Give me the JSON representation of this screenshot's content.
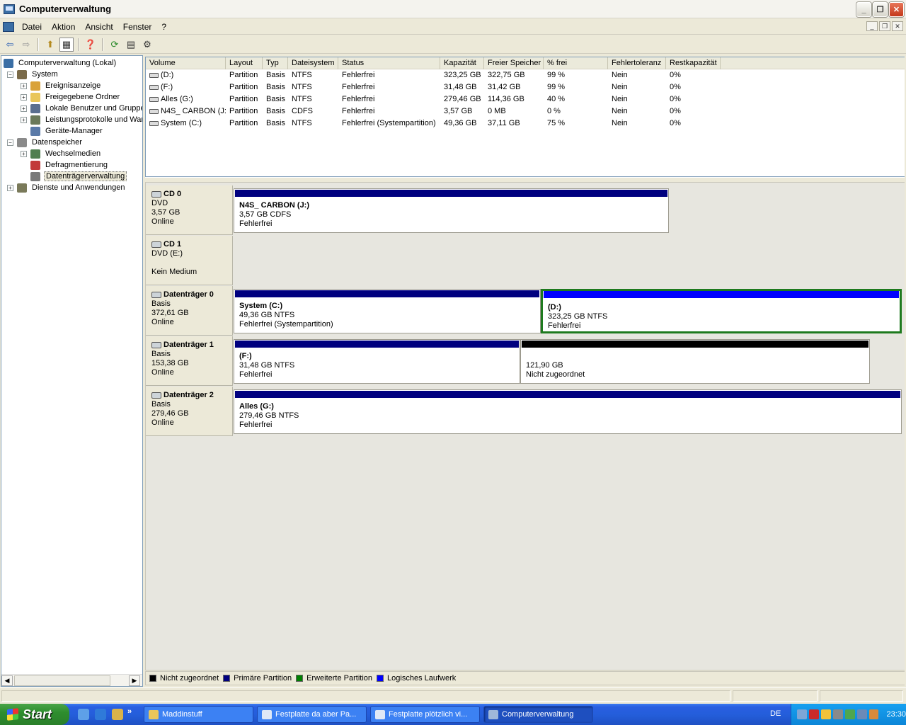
{
  "window": {
    "title": "Computerverwaltung"
  },
  "menu": {
    "items": [
      "Datei",
      "Aktion",
      "Ansicht",
      "Fenster",
      "?"
    ]
  },
  "tree": {
    "items": [
      {
        "label": "Computerverwaltung (Lokal)",
        "level": 0,
        "expander": "",
        "icon": "computer-icon",
        "color": "#3a6ea5"
      },
      {
        "label": "System",
        "level": 1,
        "expander": "−",
        "icon": "system-tools-icon",
        "color": "#7a6a48"
      },
      {
        "label": "Ereignisanzeige",
        "level": 2,
        "expander": "+",
        "icon": "event-viewer-icon",
        "color": "#d9a23a"
      },
      {
        "label": "Freigegebene Ordner",
        "level": 2,
        "expander": "+",
        "icon": "shared-folder-icon",
        "color": "#e9c65a"
      },
      {
        "label": "Lokale Benutzer und Gruppen",
        "level": 2,
        "expander": "+",
        "icon": "users-icon",
        "color": "#5a6f8f"
      },
      {
        "label": "Leistungsprotokolle und Warnungen",
        "level": 2,
        "expander": "+",
        "icon": "performance-icon",
        "color": "#6b7a5a"
      },
      {
        "label": "Geräte-Manager",
        "level": 2,
        "expander": "",
        "icon": "device-manager-icon",
        "color": "#5a7aa8"
      },
      {
        "label": "Datenspeicher",
        "level": 1,
        "expander": "−",
        "icon": "storage-icon",
        "color": "#8a8a8a"
      },
      {
        "label": "Wechselmedien",
        "level": 2,
        "expander": "+",
        "icon": "removable-media-icon",
        "color": "#4f7f4f"
      },
      {
        "label": "Defragmentierung",
        "level": 2,
        "expander": "",
        "icon": "defrag-icon",
        "color": "#c23a3a"
      },
      {
        "label": "Datenträgerverwaltung",
        "level": 2,
        "expander": "",
        "icon": "disk-management-icon",
        "color": "#7a7a7a",
        "selected": true
      },
      {
        "label": "Dienste und Anwendungen",
        "level": 1,
        "expander": "+",
        "icon": "services-icon",
        "color": "#7a7a5a"
      }
    ]
  },
  "volumes": {
    "columns": [
      "Volume",
      "Layout",
      "Typ",
      "Dateisystem",
      "Status",
      "Kapazität",
      "Freier Speicher",
      "% frei",
      "Fehlertoleranz",
      "Restkapazität"
    ],
    "rows": [
      [
        "(D:)",
        "Partition",
        "Basis",
        "NTFS",
        "Fehlerfrei",
        "323,25 GB",
        "322,75 GB",
        "99 %",
        "Nein",
        "0%"
      ],
      [
        "(F:)",
        "Partition",
        "Basis",
        "NTFS",
        "Fehlerfrei",
        "31,48 GB",
        "31,42 GB",
        "99 %",
        "Nein",
        "0%"
      ],
      [
        "Alles (G:)",
        "Partition",
        "Basis",
        "NTFS",
        "Fehlerfrei",
        "279,46 GB",
        "114,36 GB",
        "40 %",
        "Nein",
        "0%"
      ],
      [
        "N4S_ CARBON (J:)",
        "Partition",
        "Basis",
        "CDFS",
        "Fehlerfrei",
        "3,57 GB",
        "0 MB",
        "0 %",
        "Nein",
        "0%"
      ],
      [
        "System (C:)",
        "Partition",
        "Basis",
        "NTFS",
        "Fehlerfrei (Systempartition)",
        "49,36 GB",
        "37,11 GB",
        "75 %",
        "Nein",
        "0%"
      ]
    ]
  },
  "disks": [
    {
      "name": "CD 0",
      "type": "DVD",
      "size": "3,57 GB",
      "state": "Online",
      "partitions": [
        {
          "name": "N4S_ CARBON  (J:)",
          "size": "3,57 GB CDFS",
          "status": "Fehlerfrei",
          "kind": "primary",
          "share": 1.0
        }
      ],
      "used": 0.652
    },
    {
      "name": "CD 1",
      "type": "DVD (E:)",
      "size": "",
      "state": "Kein Medium",
      "partitions": [],
      "used": 0
    },
    {
      "name": "Datenträger 0",
      "type": "Basis",
      "size": "372,61 GB",
      "state": "Online",
      "partitions": [
        {
          "name": "System  (C:)",
          "size": "49,36 GB NTFS",
          "status": "Fehlerfrei (Systempartition)",
          "kind": "primary",
          "share": 0.46
        },
        {
          "name": "(D:)",
          "size": "323,25 GB NTFS",
          "status": "Fehlerfrei",
          "kind": "logical",
          "share": 0.54,
          "selected": true
        }
      ],
      "used": 1.0
    },
    {
      "name": "Datenträger 1",
      "type": "Basis",
      "size": "153,38 GB",
      "state": "Online",
      "partitions": [
        {
          "name": "(F:)",
          "size": "31,48 GB NTFS",
          "status": "Fehlerfrei",
          "kind": "primary",
          "share": 0.45
        },
        {
          "name": "",
          "size": "121,90 GB",
          "status": "Nicht zugeordnet",
          "kind": "unallocated",
          "share": 0.55
        }
      ],
      "used": 0.952
    },
    {
      "name": "Datenträger 2",
      "type": "Basis",
      "size": "279,46 GB",
      "state": "Online",
      "partitions": [
        {
          "name": "Alles  (G:)",
          "size": "279,46 GB NTFS",
          "status": "Fehlerfrei",
          "kind": "primary",
          "share": 1.0
        }
      ],
      "used": 1.0
    }
  ],
  "legend": [
    {
      "label": "Nicht zugeordnet",
      "color": "#000000"
    },
    {
      "label": "Primäre Partition",
      "color": "#00007f"
    },
    {
      "label": "Erweiterte Partition",
      "color": "#007f00"
    },
    {
      "label": "Logisches Laufwerk",
      "color": "#0000ff"
    }
  ],
  "colors": {
    "unallocated": "#000000",
    "primary": "#00007f",
    "extended": "#007f00",
    "logical": "#0000ff"
  },
  "taskbar": {
    "start": "Start",
    "tasks": [
      {
        "label": "Maddinstuff",
        "icon": "folder-icon",
        "color": "#e9c65a",
        "active": false
      },
      {
        "label": "Festplatte da aber Pa...",
        "icon": "browser-icon",
        "color": "#dfe8f6",
        "active": false
      },
      {
        "label": "Festplatte plötzlich vi...",
        "icon": "browser-icon",
        "color": "#dfe8f6",
        "active": false
      },
      {
        "label": "Computerverwaltung",
        "icon": "computer-management-icon",
        "color": "#9fb7d9",
        "active": true
      }
    ],
    "lang": "DE",
    "clock": "23:30"
  }
}
